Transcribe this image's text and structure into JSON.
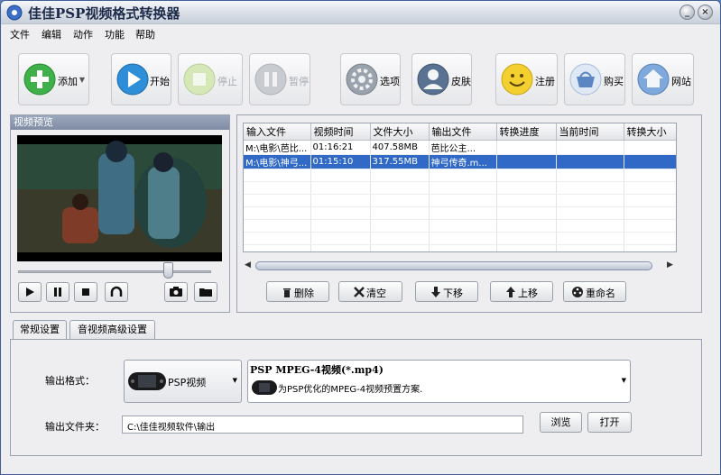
{
  "window": {
    "title": "佳佳PSP视频格式转换器",
    "controls": [
      "_",
      "□",
      "×"
    ]
  },
  "menu": [
    "文件",
    "编辑",
    "动作",
    "功能",
    "帮助"
  ],
  "toolbar": {
    "add": "添加",
    "start": "开始",
    "stop": "停止",
    "pause": "暂停",
    "options": "选项",
    "skin": "皮肤",
    "register": "注册",
    "buy": "购买",
    "website": "网站"
  },
  "preview": {
    "title": "视频预览",
    "slider_position": 0.78
  },
  "filelist": {
    "headers": [
      "输入文件",
      "视频时间",
      "文件大小",
      "输出文件",
      "转换进度",
      "当前时间",
      "转换大小"
    ],
    "rows": [
      [
        "M:\\电影\\芭比...",
        "01:16:21",
        "407.58MB",
        "芭比公主...",
        "",
        "",
        ""
      ],
      [
        "M:\\电影\\神弓...",
        "01:15:10",
        "317.55MB",
        "神弓传奇.m...",
        "",
        "",
        ""
      ]
    ],
    "selected_row": 1
  },
  "actions": {
    "delete": "删除",
    "clear": "清空",
    "down": "下移",
    "up": "上移",
    "rename": "重命名"
  },
  "tabs": {
    "general": "常规设置",
    "advanced": "音视频高级设置"
  },
  "settings": {
    "format_label": "输出格式：",
    "device": "PSP视频",
    "format_title": "PSP MPEG-4视频(*.mp4)",
    "format_desc": "为PSP优化的MPEG-4视频预置方案.",
    "folder_label": "输出文件夹：",
    "folder_value": "C:\\佳佳视频软件\\输出",
    "browse": "浏览",
    "open": "打开"
  },
  "colors": {
    "selection": "#3169c6",
    "titlebar": "#d8dde6",
    "panel_head": "#8593a9"
  },
  "icons": [
    "app-logo-icon",
    "add-icon",
    "play-icon",
    "stop-icon",
    "pause-icon",
    "gear-icon",
    "person-icon",
    "smiley-icon",
    "basket-icon",
    "home-icon",
    "trash-icon",
    "close-x-icon",
    "arrow-down-icon",
    "arrow-up-icon",
    "film-reel-icon",
    "camera-icon",
    "folder-icon",
    "loop-icon"
  ]
}
